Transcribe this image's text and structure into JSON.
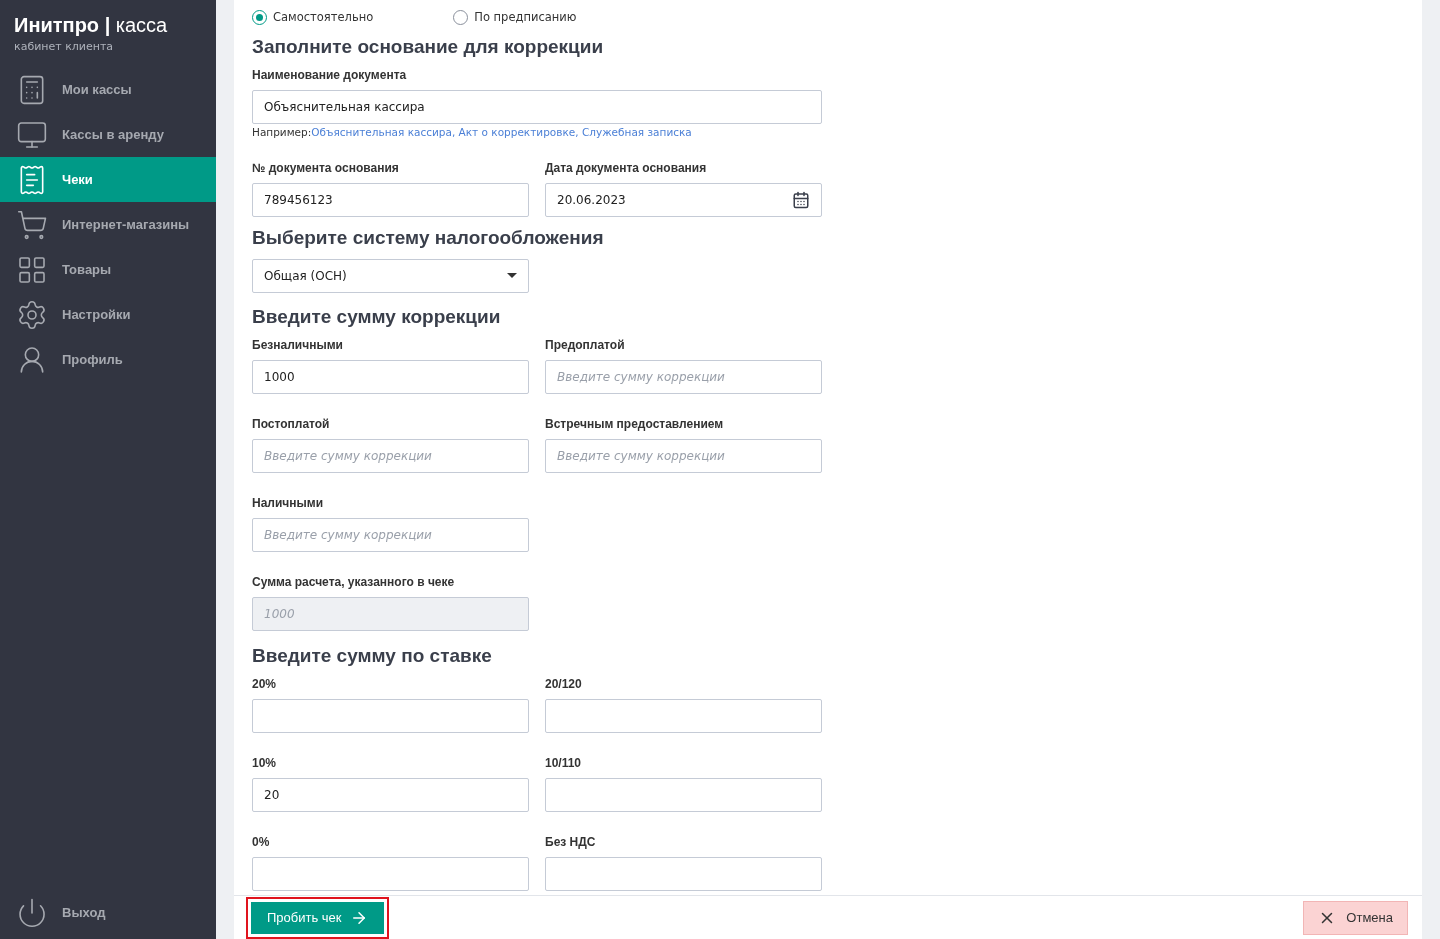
{
  "sidebar": {
    "brand": "Инитпро",
    "brand_separator": "|",
    "brand_suffix": "касса",
    "subtitle": "кабинет клиента",
    "items": [
      {
        "label": "Мои кассы",
        "selected": false
      },
      {
        "label": "Кассы в аренду",
        "selected": false
      },
      {
        "label": "Чеки",
        "selected": true
      },
      {
        "label": "Интернет-магазины",
        "selected": false
      },
      {
        "label": "Товары",
        "selected": false
      },
      {
        "label": "Настройки",
        "selected": false
      },
      {
        "label": "Профиль",
        "selected": false
      }
    ],
    "logout": "Выход"
  },
  "mode_options": [
    {
      "label": "Самостоятельно",
      "selected": true
    },
    {
      "label": "По предписанию",
      "selected": false
    }
  ],
  "sections": [
    {
      "title": "Заполните основание для коррекции",
      "fields": [
        {
          "kind": "text",
          "wide": true,
          "label": "Наименование документа",
          "value": "Объяснительная кассира",
          "hint": {
            "prefix": "Например:",
            "examples": "Объяснительная кассира, Акт о корректировке, Служебная записка"
          }
        },
        {
          "kind": "text",
          "label": "№ документа основания",
          "value": "789456123"
        },
        {
          "kind": "date",
          "label": "Дата документа основания",
          "value": "20.06.2023"
        }
      ]
    },
    {
      "title": "Выберите систему налогообложения",
      "fields": [
        {
          "kind": "select",
          "value": "Общая (ОСН)"
        }
      ]
    },
    {
      "title": "Введите сумму коррекции",
      "fields": [
        {
          "kind": "text",
          "label": "Безналичными",
          "value": "1000"
        },
        {
          "kind": "text",
          "label": "Предоплатой",
          "placeholder": "Введите сумму коррекции"
        },
        {
          "kind": "text",
          "label": "Постоплатой",
          "placeholder": "Введите сумму коррекции"
        },
        {
          "kind": "text",
          "label": "Встречным предоставлением",
          "placeholder": "Введите сумму коррекции"
        },
        {
          "kind": "text",
          "label": "Наличными",
          "placeholder": "Введите сумму коррекции"
        },
        {
          "kind": "break"
        },
        {
          "kind": "text",
          "label": "Сумма расчета, указанного в чеке",
          "placeholder": "1000",
          "disabled": true
        }
      ]
    },
    {
      "title": "Введите сумму по ставке",
      "fields": [
        {
          "kind": "text",
          "label": "20%"
        },
        {
          "kind": "text",
          "label": "20/120"
        },
        {
          "kind": "text",
          "label": "10%",
          "value": "20"
        },
        {
          "kind": "text",
          "label": "10/110"
        },
        {
          "kind": "text",
          "label": "0%"
        },
        {
          "kind": "text",
          "label": "Без НДС"
        }
      ]
    }
  ],
  "footer": {
    "submit": {
      "label": "Пробить чек",
      "highlighted": true
    },
    "cancel": "Отмена"
  }
}
